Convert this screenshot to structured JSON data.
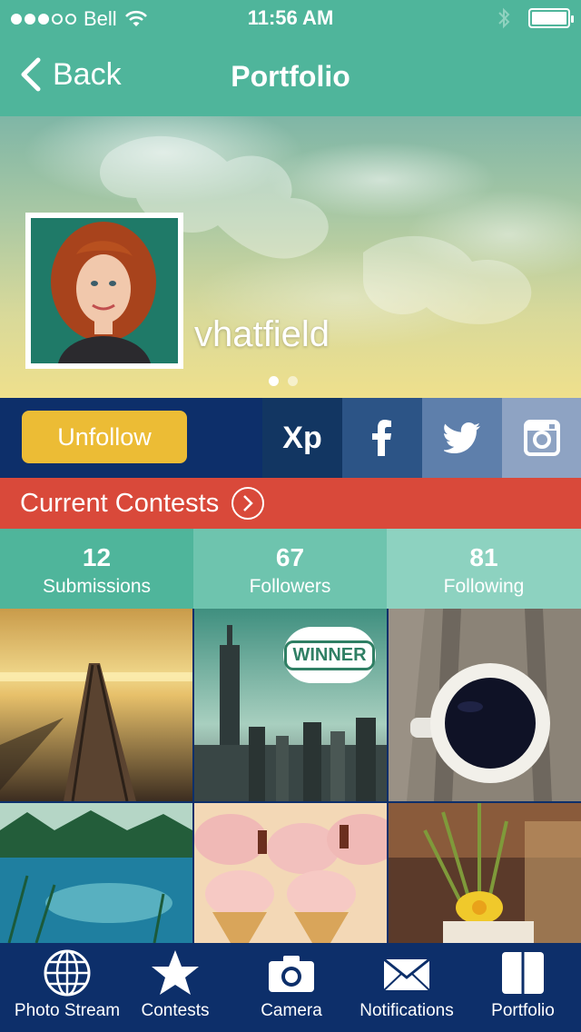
{
  "status": {
    "carrier": "Bell",
    "time": "11:56 AM",
    "signal_dots": 5,
    "signal_filled": 3,
    "battery_level": 1.0
  },
  "nav": {
    "back_label": "Back",
    "title": "Portfolio"
  },
  "profile": {
    "username": "vhatfield",
    "pager_pages": 2,
    "pager_active": 1
  },
  "actions": {
    "unfollow_label": "Unfollow",
    "xp_label": "Xp",
    "social_icons": [
      "facebook-icon",
      "twitter-icon",
      "instagram-icon"
    ]
  },
  "contests": {
    "label": "Current Contests"
  },
  "stats": [
    {
      "value": "12",
      "label": "Submissions"
    },
    {
      "value": "67",
      "label": "Followers"
    },
    {
      "value": "81",
      "label": "Following"
    }
  ],
  "photos": {
    "winner_badge": "WINNER",
    "items": [
      "pier-sunset",
      "city-skyline",
      "coffee-cup",
      "lake-reflection",
      "cupcakes",
      "daffodil"
    ]
  },
  "tabs": [
    {
      "label": "Photo Stream",
      "icon": "globe-icon"
    },
    {
      "label": "Contests",
      "icon": "star-icon"
    },
    {
      "label": "Camera",
      "icon": "camera-icon"
    },
    {
      "label": "Notifications",
      "icon": "envelope-icon"
    },
    {
      "label": "Portfolio",
      "icon": "book-icon"
    }
  ],
  "colors": {
    "teal": "#4fb59b",
    "navy": "#0d2f6a",
    "red": "#d9493a",
    "yellow": "#ecbc35"
  }
}
